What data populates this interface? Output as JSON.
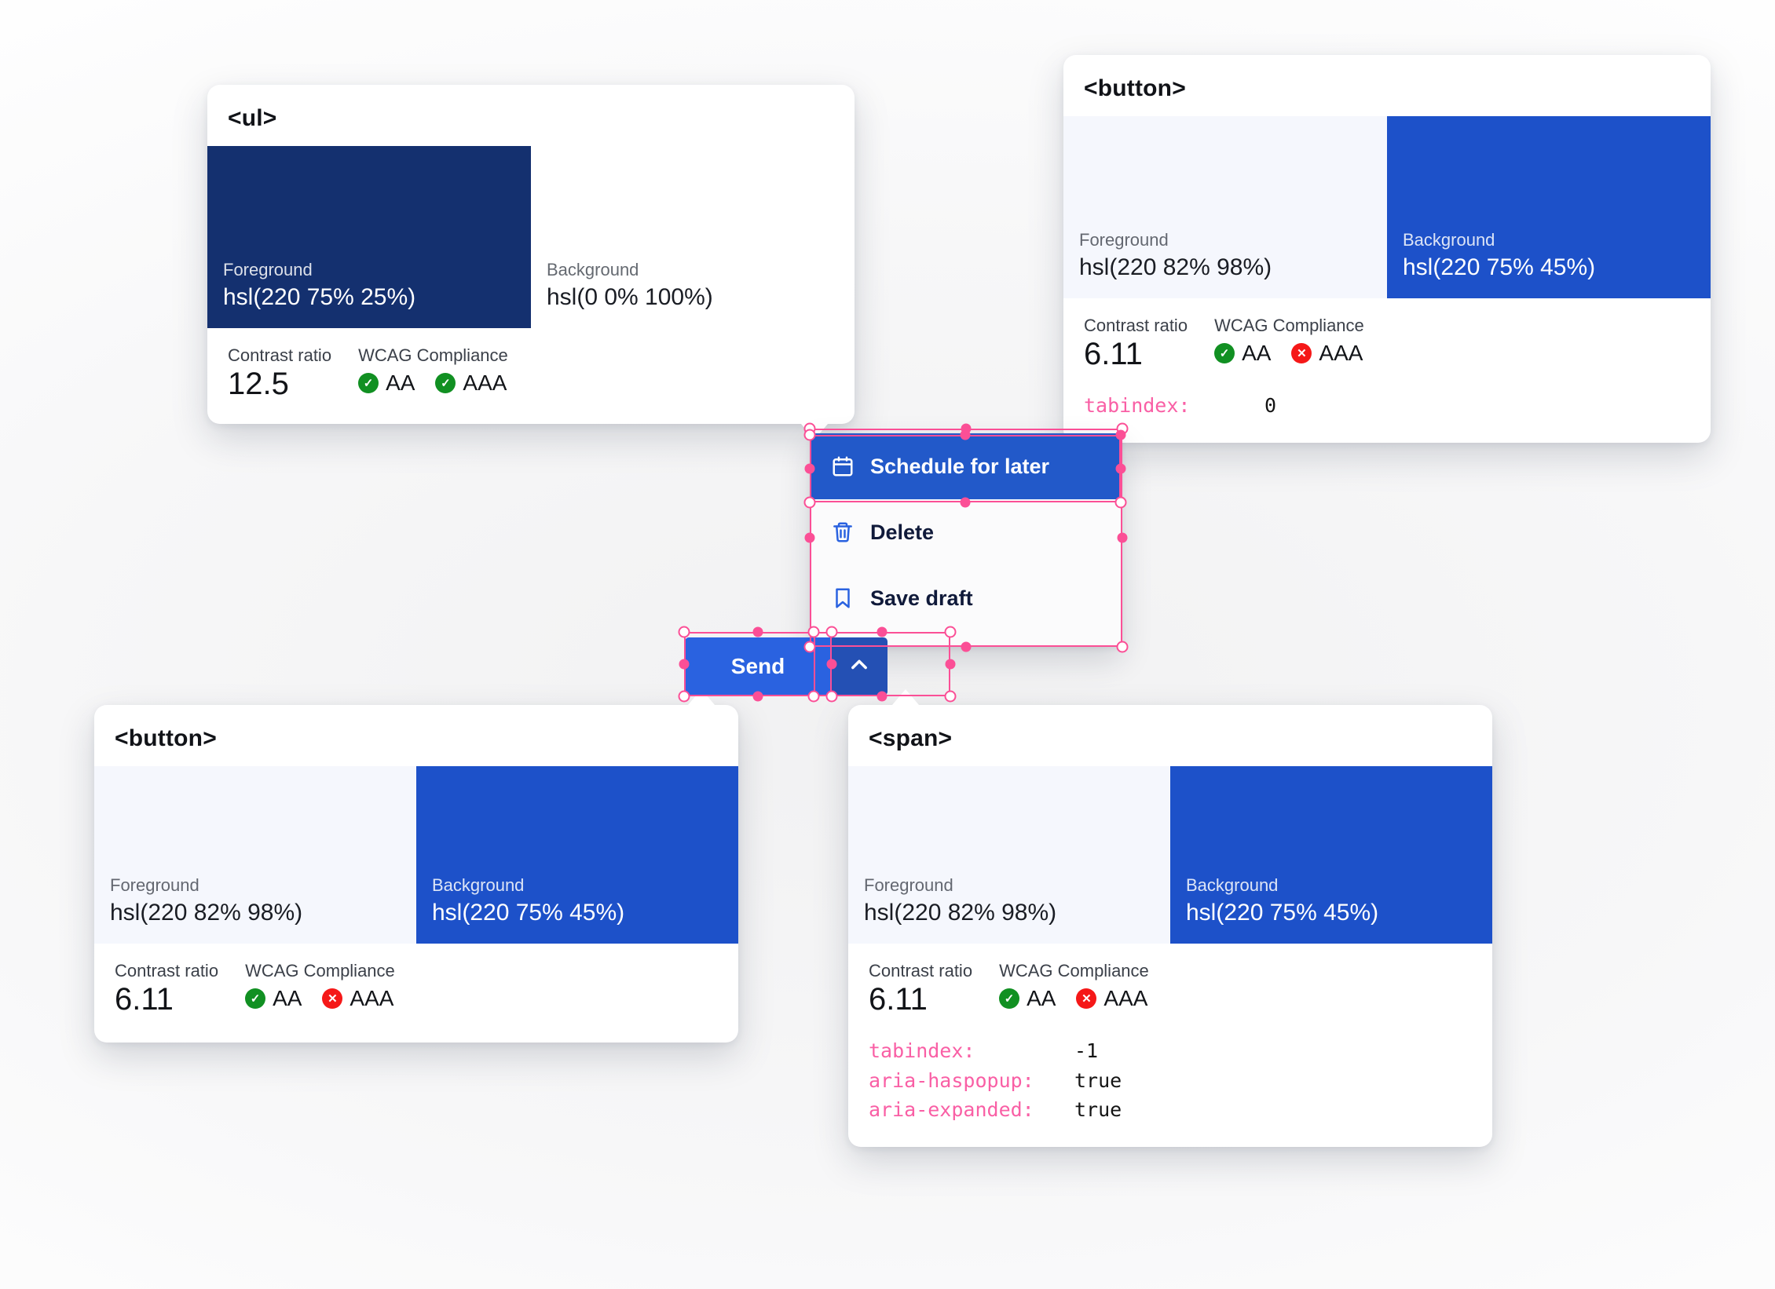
{
  "cards": [
    {
      "id": "ul",
      "title": "<ul>",
      "foreground": {
        "label": "Foreground",
        "value": "hsl(220 75% 25%)",
        "color": "#14306f"
      },
      "background": {
        "label": "Background",
        "value": "hsl(0 0% 100%)",
        "color": "#ffffff"
      },
      "contrast": {
        "label": "Contrast ratio",
        "value": "12.5"
      },
      "wcag": {
        "label": "WCAG Compliance",
        "items": [
          {
            "level": "AA",
            "pass": true,
            "glyph": "check-icon"
          },
          {
            "level": "AAA",
            "pass": true,
            "glyph": "check-icon"
          }
        ]
      },
      "attributes": []
    },
    {
      "id": "button-top",
      "title": "<button>",
      "foreground": {
        "label": "Foreground",
        "value": "hsl(220 82% 98%)",
        "color": "#f5f7fd"
      },
      "background": {
        "label": "Background",
        "value": "hsl(220 75% 45%)",
        "color": "#1d51c9"
      },
      "contrast": {
        "label": "Contrast ratio",
        "value": "6.11"
      },
      "wcag": {
        "label": "WCAG Compliance",
        "items": [
          {
            "level": "AA",
            "pass": true,
            "glyph": "check-icon"
          },
          {
            "level": "AAA",
            "pass": false,
            "glyph": "cross-icon"
          }
        ]
      },
      "attributes": [
        {
          "key": "tabindex:",
          "value": "0"
        }
      ]
    },
    {
      "id": "button-bottom",
      "title": "<button>",
      "foreground": {
        "label": "Foreground",
        "value": "hsl(220 82% 98%)",
        "color": "#f5f7fd"
      },
      "background": {
        "label": "Background",
        "value": "hsl(220 75% 45%)",
        "color": "#1d51c9"
      },
      "contrast": {
        "label": "Contrast ratio",
        "value": "6.11"
      },
      "wcag": {
        "label": "WCAG Compliance",
        "items": [
          {
            "level": "AA",
            "pass": true,
            "glyph": "check-icon"
          },
          {
            "level": "AAA",
            "pass": false,
            "glyph": "cross-icon"
          }
        ]
      },
      "attributes": []
    },
    {
      "id": "span",
      "title": "<span>",
      "foreground": {
        "label": "Foreground",
        "value": "hsl(220 82% 98%)",
        "color": "#f5f7fd"
      },
      "background": {
        "label": "Background",
        "value": "hsl(220 75% 45%)",
        "color": "#1d51c9"
      },
      "contrast": {
        "label": "Contrast ratio",
        "value": "6.11"
      },
      "wcag": {
        "label": "WCAG Compliance",
        "items": [
          {
            "level": "AA",
            "pass": true,
            "glyph": "check-icon"
          },
          {
            "level": "AAA",
            "pass": false,
            "glyph": "cross-icon"
          }
        ]
      },
      "attributes": [
        {
          "key": "tabindex:",
          "value": "-1"
        },
        {
          "key": "aria-haspopup:",
          "value": "true"
        },
        {
          "key": "aria-expanded:",
          "value": "true"
        }
      ]
    }
  ],
  "menu": {
    "items": [
      {
        "label": "Schedule for later",
        "icon": "calendar-icon",
        "selected": true
      },
      {
        "label": "Delete",
        "icon": "trash-icon",
        "selected": false
      },
      {
        "label": "Save draft",
        "icon": "bookmark-icon",
        "selected": false
      }
    ]
  },
  "send_button": {
    "label": "Send",
    "toggle_icon": "chevron-up-icon"
  },
  "colors": {
    "accent_blue": "#2a62e0",
    "selection_pink": "#fb4f96",
    "pass_green": "#119022",
    "fail_red": "#f51818",
    "attr_key_pink": "#f95fa5"
  }
}
